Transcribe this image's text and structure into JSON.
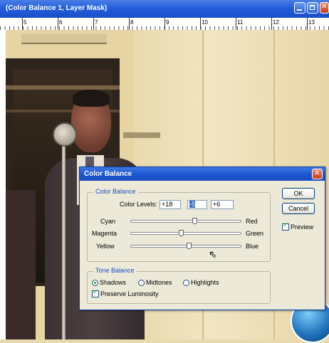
{
  "document": {
    "title": "(Color Balance 1, Layer Mask)",
    "ruler_numbers": [
      "5",
      "6",
      "7",
      "8",
      "9",
      "10",
      "11",
      "12",
      "13"
    ]
  },
  "dialog": {
    "title": "Color Balance",
    "color_balance_group": {
      "legend": "Color Balance",
      "color_levels_label": "Color Levels:",
      "levels": [
        "+18",
        "-5",
        "+6"
      ],
      "sliders": [
        {
          "left": "Cyan",
          "right": "Red",
          "value": 18
        },
        {
          "left": "Magenta",
          "right": "Green",
          "value": -5
        },
        {
          "left": "Yellow",
          "right": "Blue",
          "value": 6
        }
      ]
    },
    "tone_balance_group": {
      "legend": "Tone Balance",
      "options": [
        "Shadows",
        "Midtones",
        "Highlights"
      ],
      "selected": "Shadows",
      "preserve_luminosity": "Preserve Luminosity"
    },
    "buttons": {
      "ok": "OK",
      "cancel": "Cancel"
    },
    "preview_label": "Preview"
  },
  "colors": {
    "title_bar": "#245edb",
    "dialog_bg": "#ece9d8",
    "group_legend": "#1f4eb8"
  }
}
